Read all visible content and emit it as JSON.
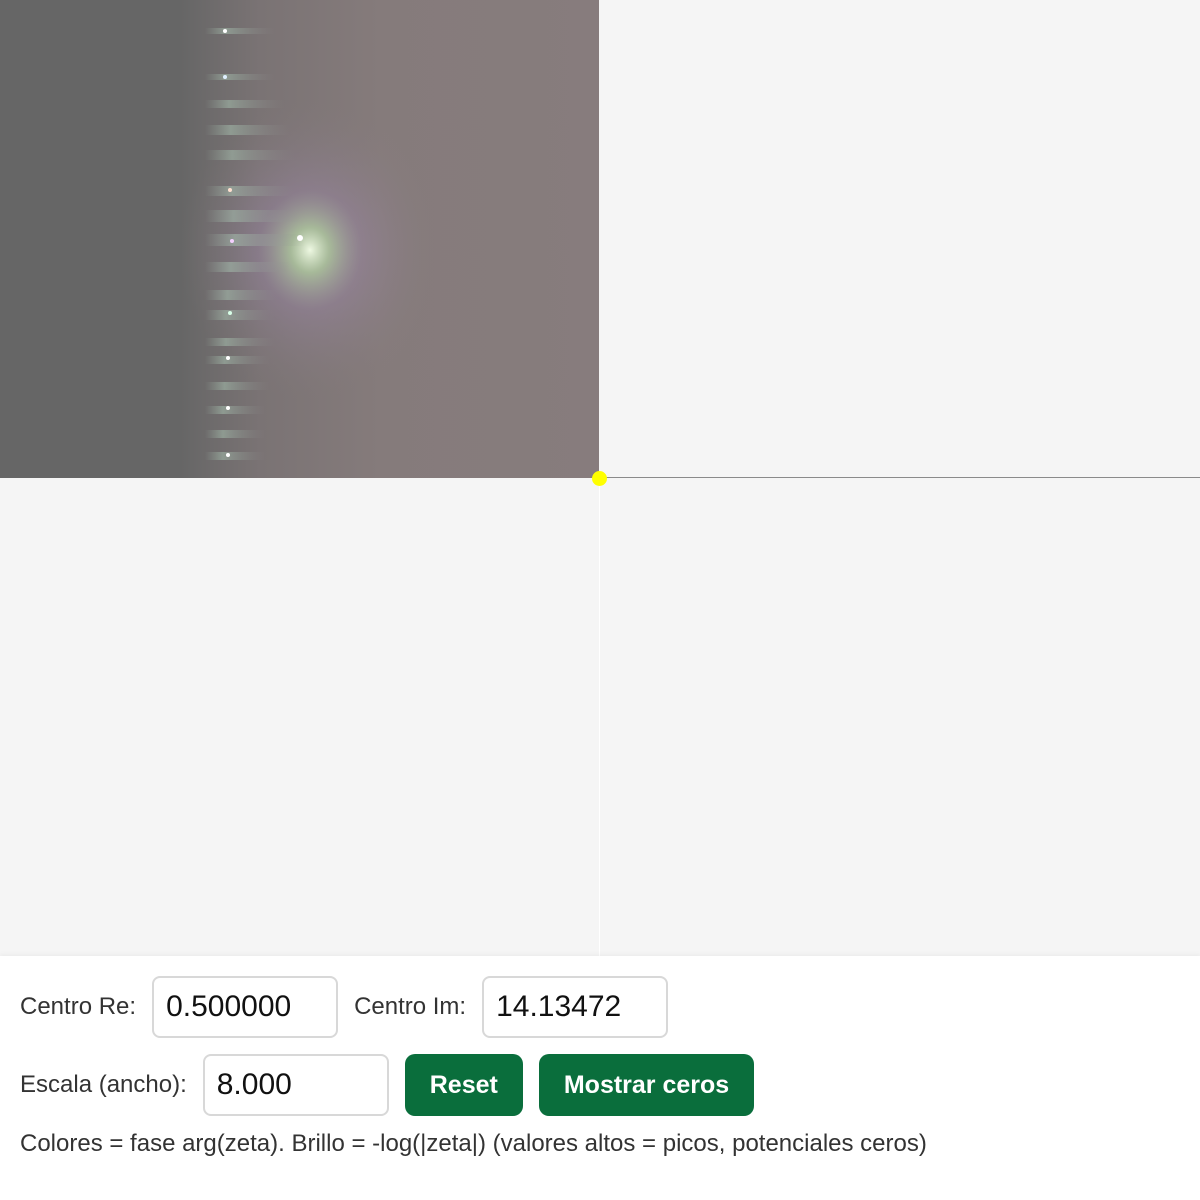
{
  "controls": {
    "centro_re": {
      "label": "Centro Re:",
      "value": "0.500000"
    },
    "centro_im": {
      "label": "Centro Im:",
      "value": "14.13472"
    },
    "escala": {
      "label": "Escala (ancho):",
      "value": "8.000"
    },
    "reset_label": "Reset",
    "mostrar_ceros_label": "Mostrar ceros",
    "description": "Colores = fase arg(zeta). Brillo = -log(|zeta|) (valores altos = picos, potenciales ceros)"
  },
  "colors": {
    "accent": "#0a6e3c",
    "center_marker": "#ffff00",
    "canvas_background": "#f5f5f5"
  },
  "icons": {
    "center_marker": "center-point-marker"
  }
}
